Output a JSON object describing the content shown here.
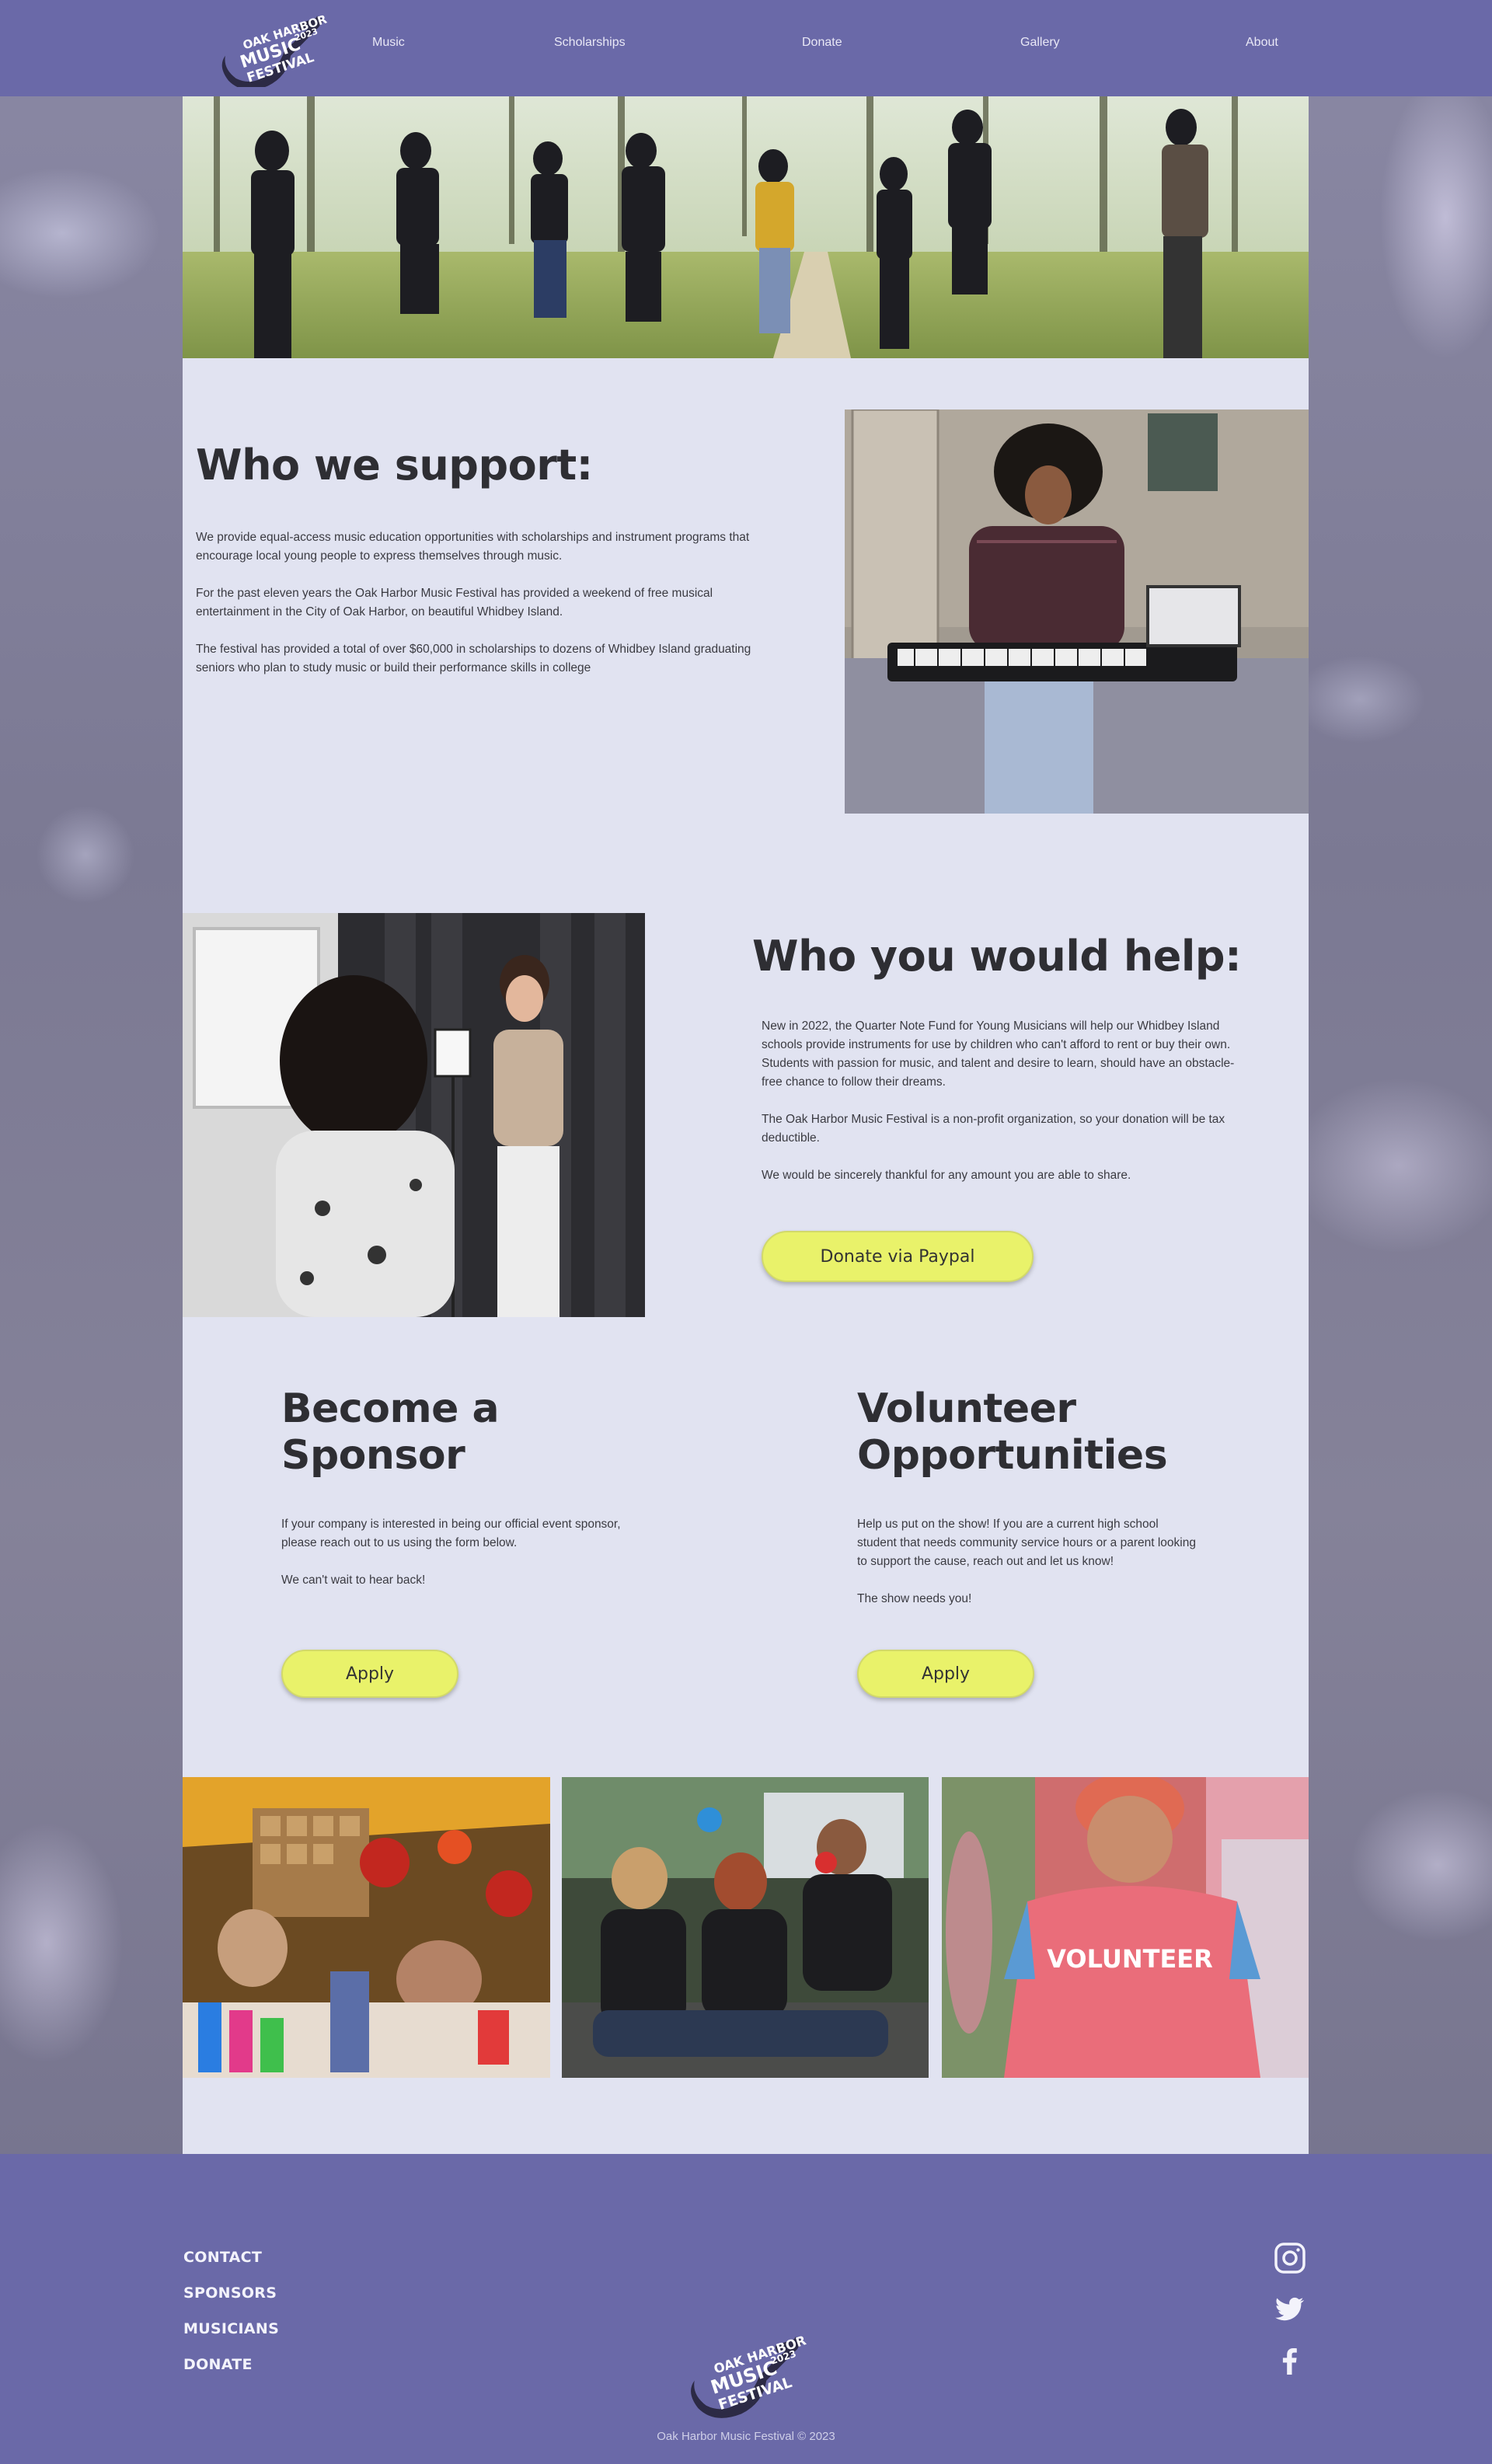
{
  "brand": {
    "logo_text": [
      "OAK HARBOR",
      "MUSIC",
      "FESTIVAL",
      "2023"
    ],
    "header_bg": "#6a69a8",
    "content_bg": "#e1e3f1",
    "button_color": "#e9f26a"
  },
  "nav": {
    "items": [
      {
        "label": "Music"
      },
      {
        "label": "Scholarships"
      },
      {
        "label": "Donate"
      },
      {
        "label": "Gallery"
      },
      {
        "label": "About"
      }
    ]
  },
  "support": {
    "title": "Who we support:",
    "paragraphs": [
      "We provide equal-access music education opportunities with scholarships and instrument programs that encourage local young people to express themselves through music.",
      "For the past eleven years the Oak Harbor Music Festival has provided a weekend of free musical entertainment in the City of Oak Harbor, on beautiful Whidbey Island.",
      "The festival has provided a total of over $60,000 in scholarships to dozens of Whidbey Island graduating seniors who plan to study music or build their performance skills in college"
    ]
  },
  "help": {
    "title": "Who you would help:",
    "paragraphs": [
      "New in 2022, the Quarter Note Fund for Young Musicians will help our Whidbey Island schools provide instruments for use by children who can't afford to rent or buy their own. Students with passion for music, and talent and desire to learn, should have an obstacle-free chance to follow their dreams.",
      "The Oak Harbor Music Festival is a non-profit organization, so your donation will be tax deductible.",
      "We would be sincerely thankful for any amount you are able to share."
    ],
    "donate_label": "Donate via Paypal"
  },
  "sponsor": {
    "title_line1": "Become a",
    "title_line2": "Sponsor",
    "paragraphs": [
      "If your company is interested in being our official event sponsor, please reach out to us using the form below.",
      "We can't wait to hear back!"
    ],
    "apply_label": "Apply"
  },
  "volunteer": {
    "title_line1": "Volunteer",
    "title_line2": "Opportunities",
    "paragraphs": [
      "Help us put on the show! If you are a current high school student that needs community service hours or a parent looking to support the cause, reach out and let us know!",
      "The show needs you!"
    ],
    "apply_label": "Apply",
    "photo_shirt_text": "VOLUNTEER"
  },
  "footer": {
    "links": [
      "CONTACT",
      "SPONSORS",
      "MUSICIANS",
      "DONATE"
    ],
    "social_icons": [
      "instagram-icon",
      "twitter-icon",
      "facebook-icon"
    ],
    "copyright": "Oak Harbor Music Festival © 2023"
  }
}
